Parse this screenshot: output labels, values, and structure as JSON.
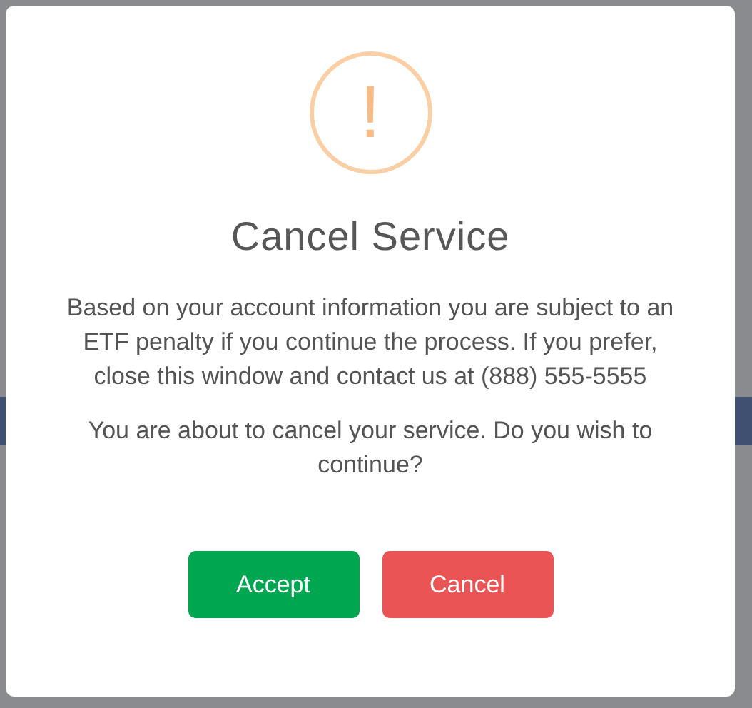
{
  "dialog": {
    "icon_text": "!",
    "title": "Cancel Service",
    "messages": [
      "Based on your account information you are subject to an ETF penalty if you continue the process. If you prefer, close this window and contact us at (888) 555-5555",
      "You are about to cancel your service. Do you wish to continue?"
    ],
    "buttons": [
      {
        "label": "Accept",
        "kind": "confirm"
      },
      {
        "label": "Cancel",
        "kind": "cancel"
      }
    ]
  }
}
